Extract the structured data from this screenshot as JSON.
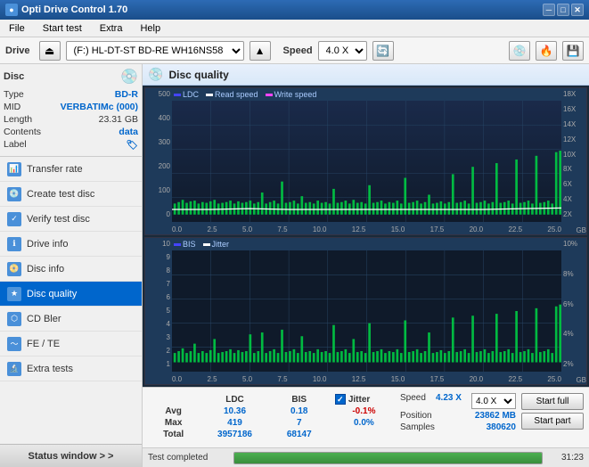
{
  "app": {
    "title": "Opti Drive Control 1.70",
    "icon": "●"
  },
  "titlebar": {
    "minimize": "─",
    "maximize": "□",
    "close": "✕"
  },
  "menu": {
    "items": [
      "File",
      "Start test",
      "Extra",
      "Help"
    ]
  },
  "toolbar": {
    "drive_label": "Drive",
    "drive_value": "(F:)  HL-DT-ST BD-RE  WH16NS58 TST4",
    "speed_label": "Speed",
    "speed_value": "4.0 X"
  },
  "disc": {
    "header": "Disc",
    "type_label": "Type",
    "type_value": "BD-R",
    "mid_label": "MID",
    "mid_value": "VERBATIMc (000)",
    "length_label": "Length",
    "length_value": "23.31 GB",
    "contents_label": "Contents",
    "contents_value": "data",
    "label_label": "Label",
    "label_value": ""
  },
  "nav": {
    "items": [
      {
        "id": "transfer-rate",
        "label": "Transfer rate",
        "icon": "📊"
      },
      {
        "id": "create-test-disc",
        "label": "Create test disc",
        "icon": "💿"
      },
      {
        "id": "verify-test-disc",
        "label": "Verify test disc",
        "icon": "✓"
      },
      {
        "id": "drive-info",
        "label": "Drive info",
        "icon": "ℹ"
      },
      {
        "id": "disc-info",
        "label": "Disc info",
        "icon": "📀"
      },
      {
        "id": "disc-quality",
        "label": "Disc quality",
        "icon": "★"
      },
      {
        "id": "cd-bler",
        "label": "CD Bler",
        "icon": "⬡"
      },
      {
        "id": "fe-te",
        "label": "FE / TE",
        "icon": "〜"
      },
      {
        "id": "extra-tests",
        "label": "Extra tests",
        "icon": "🔬"
      }
    ],
    "active": "disc-quality"
  },
  "status_window": {
    "label": "Status window > >"
  },
  "disc_quality": {
    "title": "Disc quality"
  },
  "chart1": {
    "title": "LDC",
    "legend": [
      {
        "label": "LDC",
        "color": "#4444ff"
      },
      {
        "label": "Read speed",
        "color": "#ffffff"
      },
      {
        "label": "Write speed",
        "color": "#ff44ff"
      }
    ],
    "y_left": [
      "500",
      "400",
      "300",
      "200",
      "100",
      "0"
    ],
    "y_right": [
      "18X",
      "16X",
      "14X",
      "12X",
      "10X",
      "8X",
      "6X",
      "4X",
      "2X"
    ],
    "x_labels": [
      "0.0",
      "2.5",
      "5.0",
      "7.5",
      "10.0",
      "12.5",
      "15.0",
      "17.5",
      "20.0",
      "22.5",
      "25.0"
    ],
    "unit": "GB"
  },
  "chart2": {
    "title": "BIS",
    "legend": [
      {
        "label": "BIS",
        "color": "#4444ff"
      },
      {
        "label": "Jitter",
        "color": "#ffffff"
      }
    ],
    "y_left": [
      "10",
      "9",
      "8",
      "7",
      "6",
      "5",
      "4",
      "3",
      "2",
      "1"
    ],
    "y_right": [
      "10%",
      "8%",
      "6%",
      "4%",
      "2%"
    ],
    "x_labels": [
      "0.0",
      "2.5",
      "5.0",
      "7.5",
      "10.0",
      "12.5",
      "15.0",
      "17.5",
      "20.0",
      "22.5",
      "25.0"
    ],
    "unit": "GB"
  },
  "stats": {
    "columns": [
      "LDC",
      "BIS",
      "",
      "Jitter"
    ],
    "rows": [
      {
        "label": "Avg",
        "ldc": "10.36",
        "bis": "0.18",
        "jitter": "-0.1%"
      },
      {
        "label": "Max",
        "ldc": "419",
        "bis": "7",
        "jitter": "0.0%"
      },
      {
        "label": "Total",
        "ldc": "3957186",
        "bis": "68147",
        "jitter": ""
      }
    ],
    "jitter_checked": true,
    "jitter_label": "Jitter",
    "speed_label": "Speed",
    "speed_value": "4.23 X",
    "speed_select": "4.0 X",
    "position_label": "Position",
    "position_value": "23862 MB",
    "samples_label": "Samples",
    "samples_value": "380620",
    "btn_start_full": "Start full",
    "btn_start_part": "Start part"
  },
  "progress": {
    "status": "Test completed",
    "percent": 100,
    "time": "31:23"
  }
}
